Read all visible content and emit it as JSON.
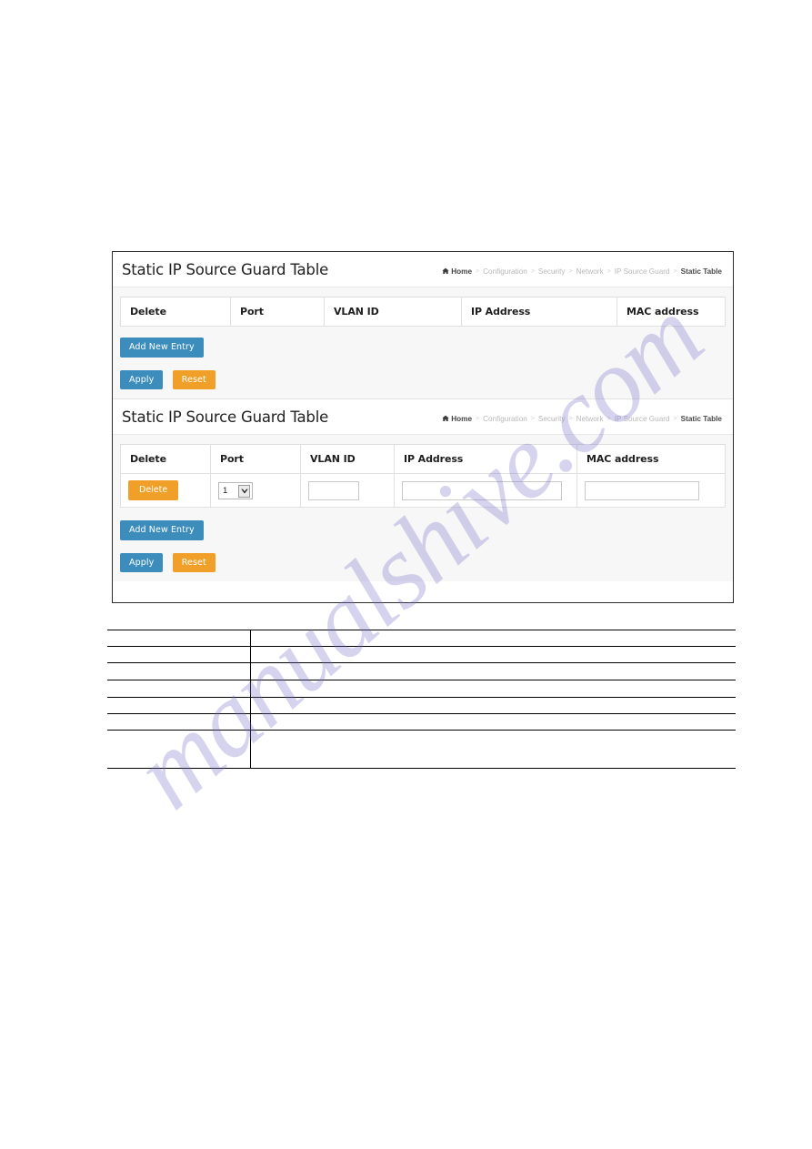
{
  "document": {
    "watermark": "manualshive.com"
  },
  "panels": [
    {
      "id": "panel-top",
      "title": "Static IP Source Guard Table",
      "breadcrumb": {
        "home_icon": "home-icon",
        "items": [
          "Home",
          "Configuration",
          "Security",
          "Network",
          "IP Source Guard",
          "Static Table"
        ],
        "separator": ">"
      },
      "table": {
        "headers": [
          "Delete",
          "Port",
          "VLAN ID",
          "IP Address",
          "MAC address"
        ],
        "rows": []
      },
      "buttons": {
        "add_new_entry": "Add New Entry",
        "apply": "Apply",
        "reset": "Reset"
      }
    },
    {
      "id": "panel-bottom",
      "title": "Static IP Source Guard Table",
      "breadcrumb": {
        "home_icon": "home-icon",
        "items": [
          "Home",
          "Configuration",
          "Security",
          "Network",
          "IP Source Guard",
          "Static Table"
        ],
        "separator": ">"
      },
      "table": {
        "headers": [
          "Delete",
          "Port",
          "VLAN ID",
          "IP Address",
          "MAC address"
        ],
        "rows": [
          {
            "delete_label": "Delete",
            "port_value": "1",
            "port_options": [
              "1"
            ],
            "vlan_id": "",
            "ip_address": "",
            "mac_address": ""
          }
        ]
      },
      "buttons": {
        "add_new_entry": "Add New Entry",
        "apply": "Apply",
        "reset": "Reset"
      }
    }
  ],
  "colors": {
    "button_blue": "#3c8dbc",
    "button_orange": "#f0a028",
    "panel_body_bg": "#f7f7f7",
    "breadcrumb_text": "#b9b9b9",
    "watermark": "#776ecb"
  },
  "ruled_table": {
    "rows": [
      {
        "left": "",
        "right": ""
      },
      {
        "left": "",
        "right": ""
      },
      {
        "left": "",
        "right": ""
      },
      {
        "left": "",
        "right": ""
      },
      {
        "left": "",
        "right": ""
      },
      {
        "left": "",
        "right": ""
      },
      {
        "left": "",
        "right": ""
      }
    ]
  }
}
